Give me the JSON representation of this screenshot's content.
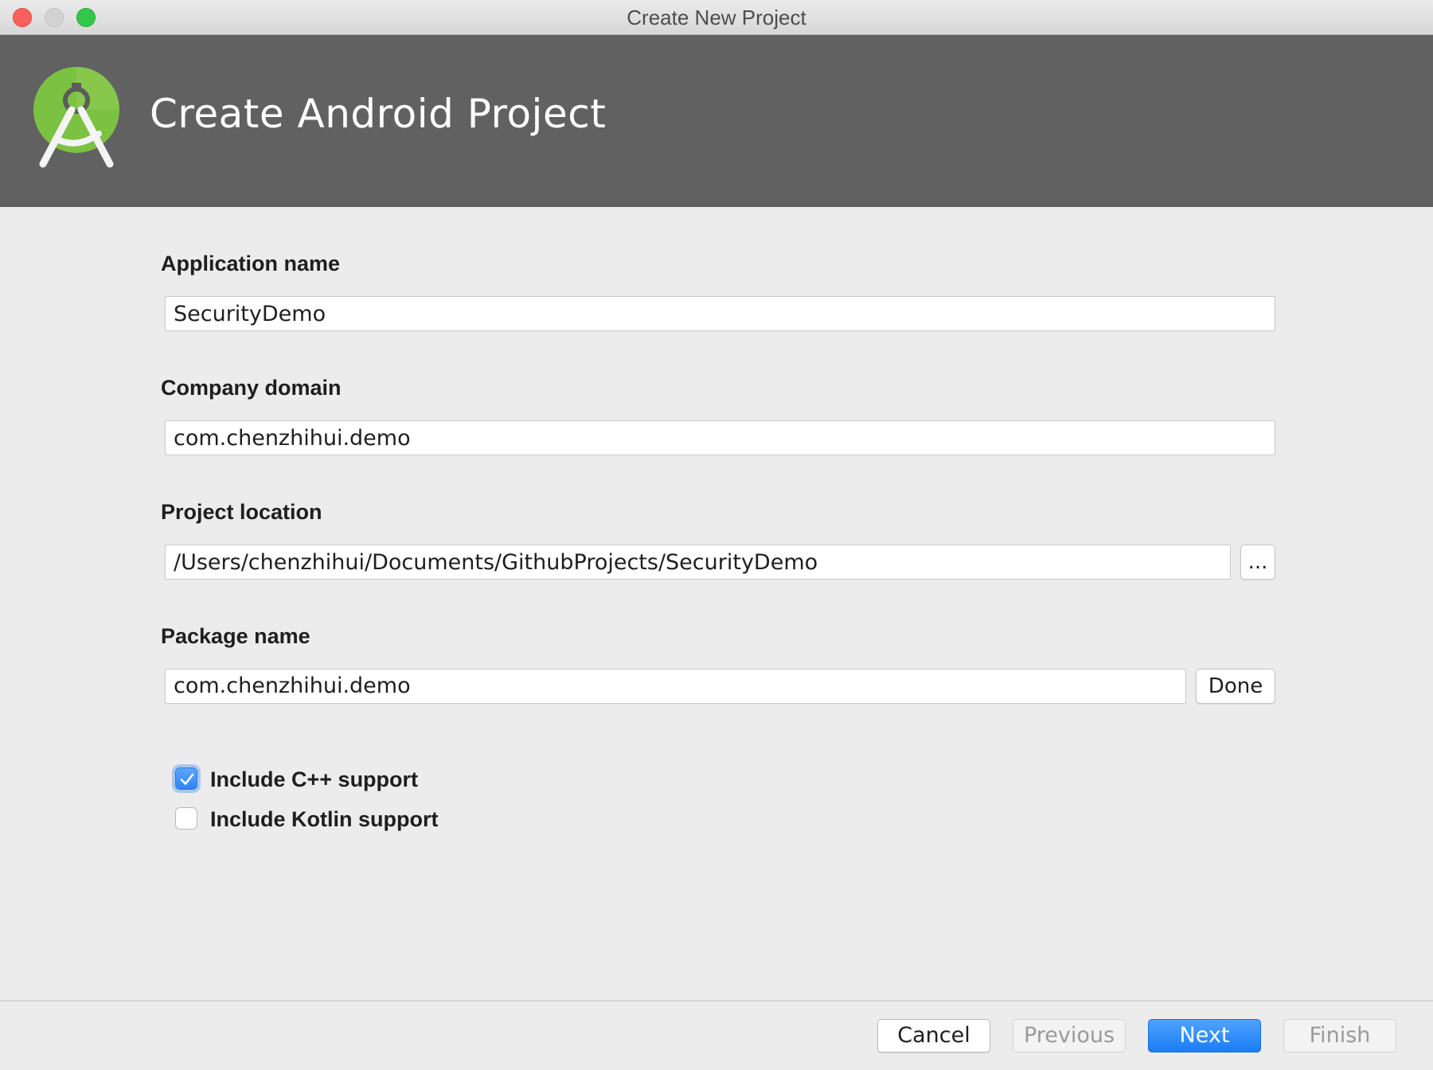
{
  "window": {
    "title": "Create New Project"
  },
  "banner": {
    "title": "Create Android Project",
    "logo_icon": "android-studio-logo-icon"
  },
  "form": {
    "app_name": {
      "label": "Application name",
      "value": "SecurityDemo"
    },
    "company_domain": {
      "label": "Company domain",
      "value": "com.chenzhihui.demo"
    },
    "project_location": {
      "label": "Project location",
      "value": "/Users/chenzhihui/Documents/GithubProjects/SecurityDemo",
      "browse_label": "..."
    },
    "package_name": {
      "label": "Package name",
      "value": "com.chenzhihui.demo",
      "done_label": "Done"
    },
    "cpp_support": {
      "label": "Include C++ support",
      "checked": true
    },
    "kotlin_support": {
      "label": "Include Kotlin support",
      "checked": false
    }
  },
  "footer": {
    "cancel_label": "Cancel",
    "previous_label": "Previous",
    "next_label": "Next",
    "finish_label": "Finish"
  },
  "colors": {
    "banner": "#616161",
    "primary": "#1a7cf5",
    "logo_green": "#7cc242"
  }
}
